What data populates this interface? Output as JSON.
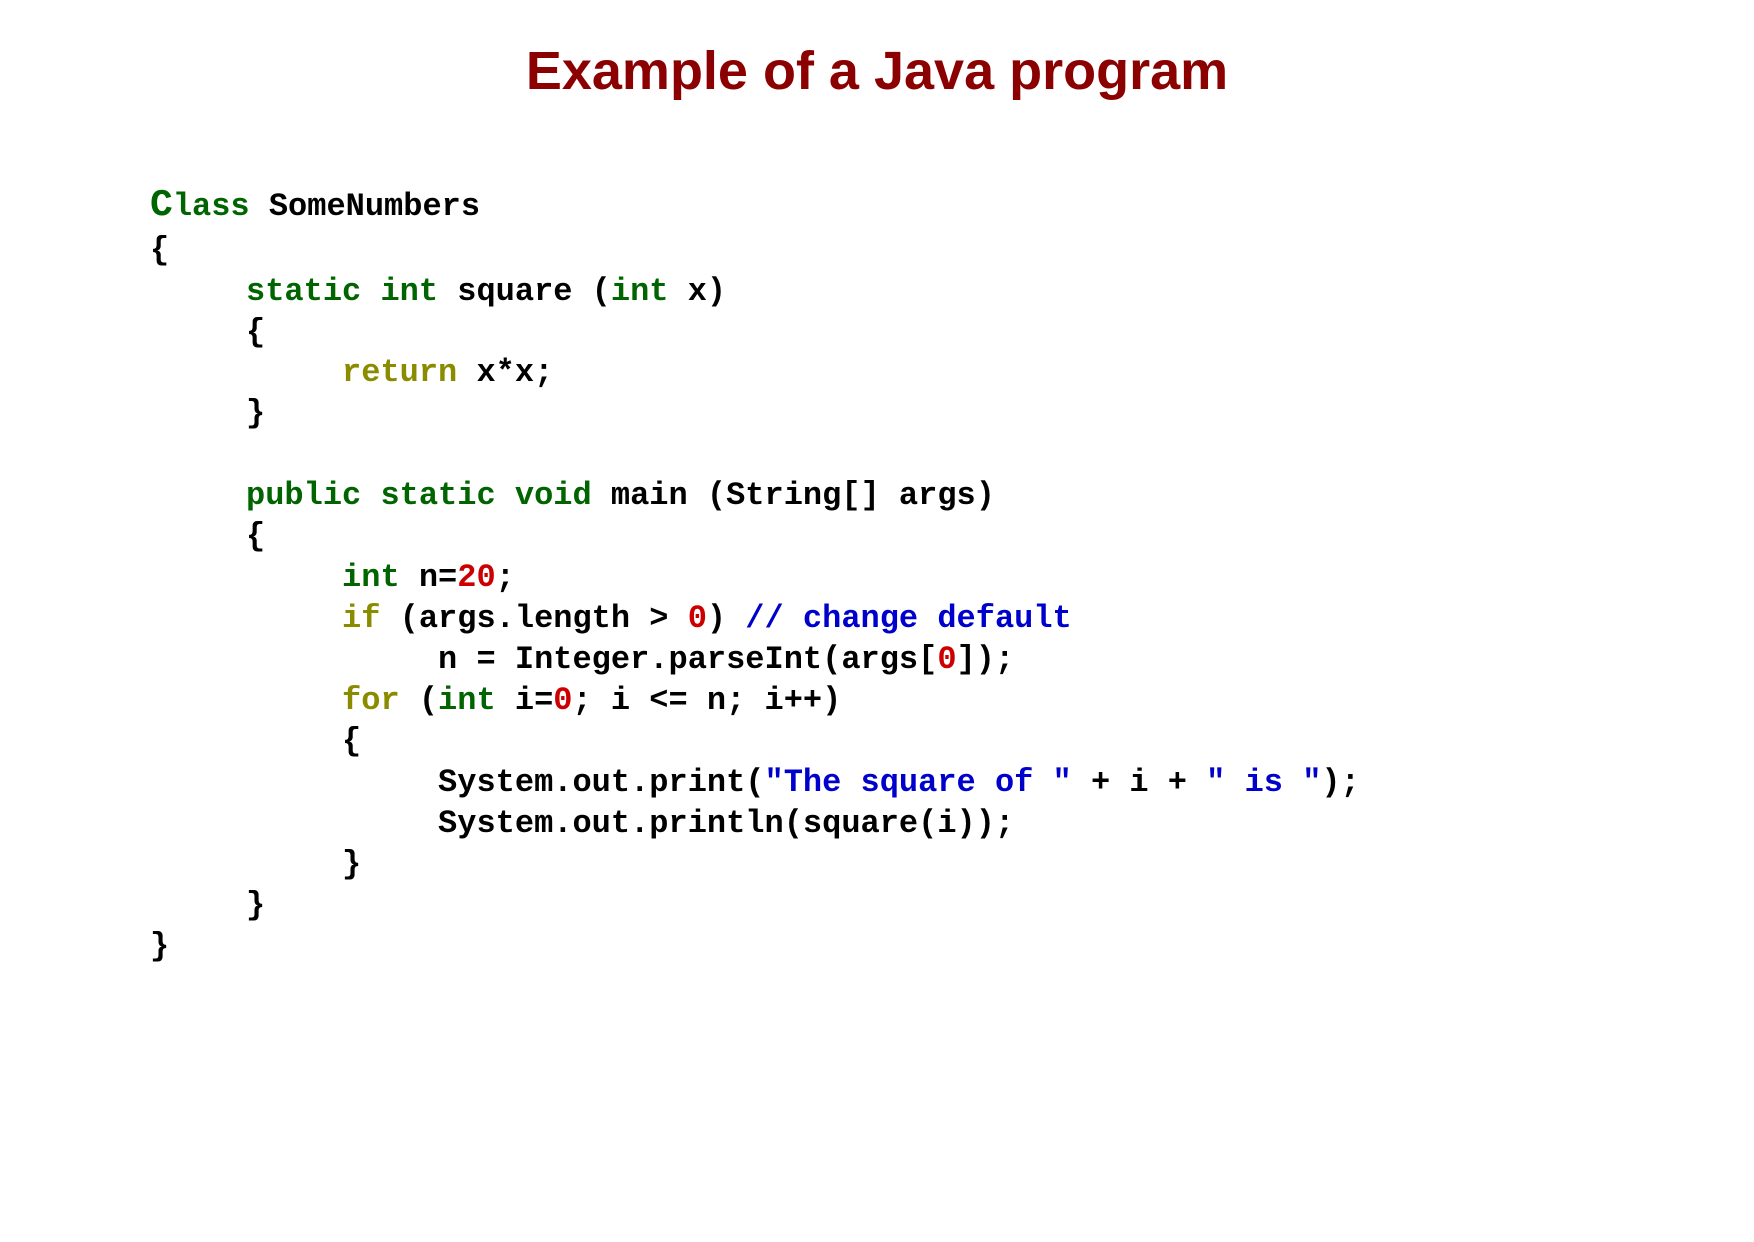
{
  "title": "Example of a Java program",
  "code": {
    "class_kw_C": "C",
    "class_kw_rest": "lass",
    "class_name": " SomeNumbers",
    "brace_open": "{",
    "indent1": "     ",
    "indent2": "          ",
    "indent3": "               ",
    "static_kw": "static",
    "int_kw": "int",
    "void_kw": "void",
    "public_kw": "public",
    "return_kw": "return",
    "if_kw": "if",
    "for_kw": "for",
    "square_sig1": " square (",
    "square_sig2": " x)",
    "return_expr": " x*x;",
    "brace_close": "}",
    "main_sig1": " main (String[] args)",
    "int_n_decl": " n=",
    "twenty": "20",
    "semicolon": ";",
    "if_cond1": " (args.length > ",
    "zero": "0",
    "if_cond2": ") ",
    "comment": "// change default",
    "parseint1": "n = Integer.parseInt(args[",
    "parseint2": "]);",
    "for_cond1": " (",
    "for_cond2": " i=",
    "for_cond3": "; i <= n; i++)",
    "sysprint": "System.out.print(",
    "str1": "\"The square of \"",
    "plus_i": " + i + ",
    "str2": "\" is \"",
    "closeparen": ");",
    "sysprintln": "System.out.println(square(i));"
  }
}
